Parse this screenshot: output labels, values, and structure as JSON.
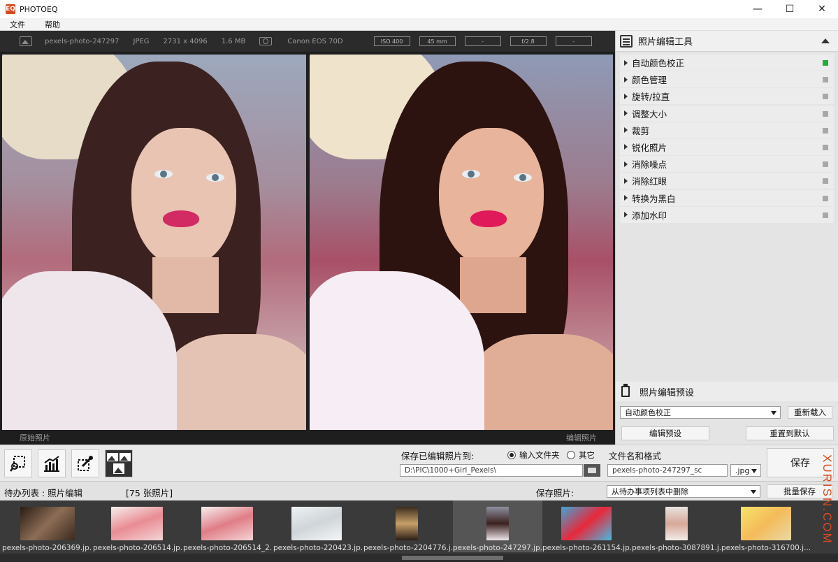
{
  "window": {
    "title": "PHOTOEQ",
    "logo_text": "EQ",
    "controls": [
      "minimize",
      "maximize",
      "close"
    ]
  },
  "menu": [
    "文件",
    "帮助"
  ],
  "info": {
    "filename": "pexels-photo-247297",
    "format": "JPEG",
    "dimensions": "2731 x 4096",
    "size": "1.6 MB",
    "camera": "Canon EOS 70D",
    "exif": [
      "ISO 400",
      "45 mm",
      "-",
      "f/2.8",
      "-"
    ]
  },
  "viewer": {
    "original_label": "原始照片",
    "edited_label": "编辑照片"
  },
  "tools_panel": {
    "title": "照片编辑工具",
    "items": [
      {
        "label": "自动颜色校正",
        "active": true
      },
      {
        "label": "颜色管理",
        "active": false
      },
      {
        "label": "旋转/拉直",
        "active": false
      },
      {
        "label": "调整大小",
        "active": false
      },
      {
        "label": "裁剪",
        "active": false
      },
      {
        "label": "锐化照片",
        "active": false
      },
      {
        "label": "消除噪点",
        "active": false
      },
      {
        "label": "消除红眼",
        "active": false
      },
      {
        "label": "转换为黑白",
        "active": false
      },
      {
        "label": "添加水印",
        "active": false
      }
    ]
  },
  "presets": {
    "title": "照片编辑预设",
    "selected": "自动颜色校正",
    "reload_label": "重新载入",
    "edit_label": "编辑预设",
    "reset_label": "重置到默认"
  },
  "save": {
    "save_to_label": "保存已编辑照片到:",
    "option_input_folder": "输入文件夹",
    "option_other": "其它",
    "path": "D:\\PIC\\1000+Girl_Pexels\\",
    "name_format_label": "文件名和格式",
    "filename": "pexels-photo-247297_sc",
    "extension": ".jpg",
    "save_button": "保存"
  },
  "queue": {
    "label": "待办列表 : 照片编辑",
    "count": "[75 张照片]",
    "save_photos_label": "保存照片:",
    "after_save_option": "从待办事项列表中删除",
    "batch_save": "批量保存"
  },
  "thumbnails": [
    {
      "name": "pexels-photo-206369.jp...",
      "selected": false
    },
    {
      "name": "pexels-photo-206514.jp...",
      "selected": false
    },
    {
      "name": "pexels-photo-206514_2...",
      "selected": false
    },
    {
      "name": "pexels-photo-220423.jp...",
      "selected": false
    },
    {
      "name": "pexels-photo-2204776.j...",
      "selected": false
    },
    {
      "name": "pexels-photo-247297.jp...",
      "selected": true
    },
    {
      "name": "pexels-photo-261154.jp...",
      "selected": false
    },
    {
      "name": "pexels-photo-3087891.j...",
      "selected": false
    },
    {
      "name": "pexels-photo-316700.j...",
      "selected": false
    }
  ],
  "watermark": "XURISN.COM",
  "colors": {
    "accent_green": "#1fae3a",
    "lips": "#d22a63",
    "watermark": "#d94a1e"
  }
}
